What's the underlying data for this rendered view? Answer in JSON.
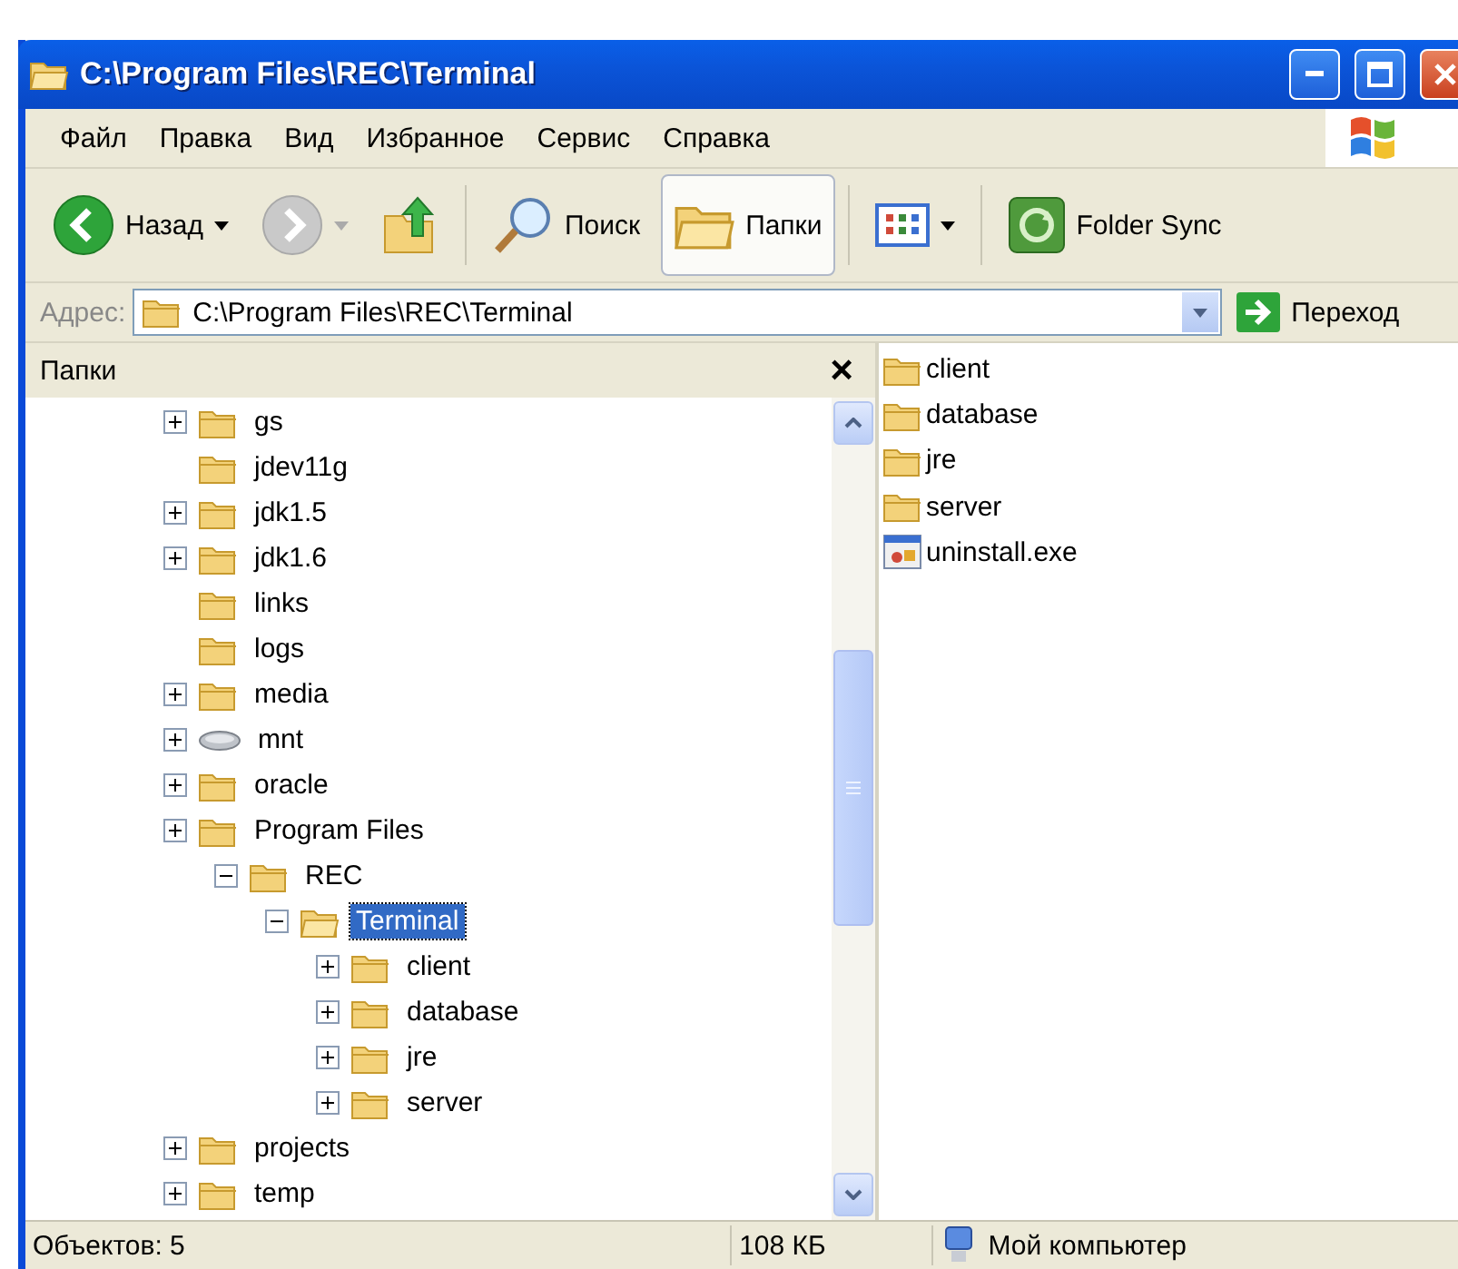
{
  "window": {
    "title": "C:\\Program Files\\REC\\Terminal"
  },
  "menu": [
    "Файл",
    "Правка",
    "Вид",
    "Избранное",
    "Сервис",
    "Справка"
  ],
  "toolbar": [
    {
      "kind": "back",
      "label": "Назад",
      "disabled": false
    },
    {
      "kind": "forward",
      "disabled": true
    },
    {
      "kind": "up"
    },
    {
      "kind": "search",
      "label": "Поиск",
      "pressed": false
    },
    {
      "kind": "folders",
      "label": "Папки",
      "pressed": true
    },
    {
      "kind": "views"
    },
    {
      "kind": "sync",
      "label": "Folder Sync"
    }
  ],
  "address": {
    "label": "Адрес:",
    "value": "C:\\Program Files\\REC\\Terminal",
    "go": "Переход"
  },
  "folders_pane": {
    "title": "Папки",
    "close": "×",
    "tree": [
      {
        "label": "gs",
        "kind": "folder",
        "expanded": false,
        "selected": false
      },
      {
        "label": "jdev11g",
        "kind": "folder",
        "selected": false
      },
      {
        "label": "jdk1.5",
        "kind": "folder",
        "expanded": false,
        "selected": false
      },
      {
        "label": "jdk1.6",
        "kind": "folder",
        "expanded": false,
        "selected": false
      },
      {
        "label": "links",
        "kind": "folder",
        "selected": false
      },
      {
        "label": "logs",
        "kind": "folder",
        "selected": false
      },
      {
        "label": "media",
        "kind": "folder",
        "expanded": false,
        "selected": false
      },
      {
        "label": "mnt",
        "kind": "drive",
        "expanded": false,
        "selected": false
      },
      {
        "label": "oracle",
        "kind": "folder",
        "expanded": false,
        "selected": false
      },
      {
        "label": "Program Files",
        "kind": "folder",
        "expanded": false,
        "selected": false,
        "children": [
          {
            "label": "REC",
            "kind": "folder",
            "expanded": true,
            "selected": false,
            "children": [
              {
                "label": "Terminal",
                "kind": "folder",
                "expanded": true,
                "selected": true,
                "children": [
                  {
                    "label": "client",
                    "kind": "folder",
                    "expanded": false,
                    "selected": false
                  },
                  {
                    "label": "database",
                    "kind": "folder",
                    "expanded": false,
                    "selected": false
                  },
                  {
                    "label": "jre",
                    "kind": "folder",
                    "expanded": false,
                    "selected": false
                  },
                  {
                    "label": "server",
                    "kind": "folder",
                    "expanded": false,
                    "selected": false
                  }
                ]
              }
            ]
          }
        ]
      },
      {
        "label": "projects",
        "kind": "folder",
        "expanded": false,
        "selected": false
      },
      {
        "label": "temp",
        "kind": "folder",
        "expanded": false,
        "selected": false
      }
    ]
  },
  "files": [
    {
      "name": "client",
      "kind": "folder"
    },
    {
      "name": "database",
      "kind": "folder"
    },
    {
      "name": "jre",
      "kind": "folder"
    },
    {
      "name": "server",
      "kind": "folder"
    },
    {
      "name": "uninstall.exe",
      "kind": "exe"
    }
  ],
  "status_bar": {
    "objects": "Объектов: 5",
    "size": "108 КБ",
    "location": "Мой компьютер"
  }
}
